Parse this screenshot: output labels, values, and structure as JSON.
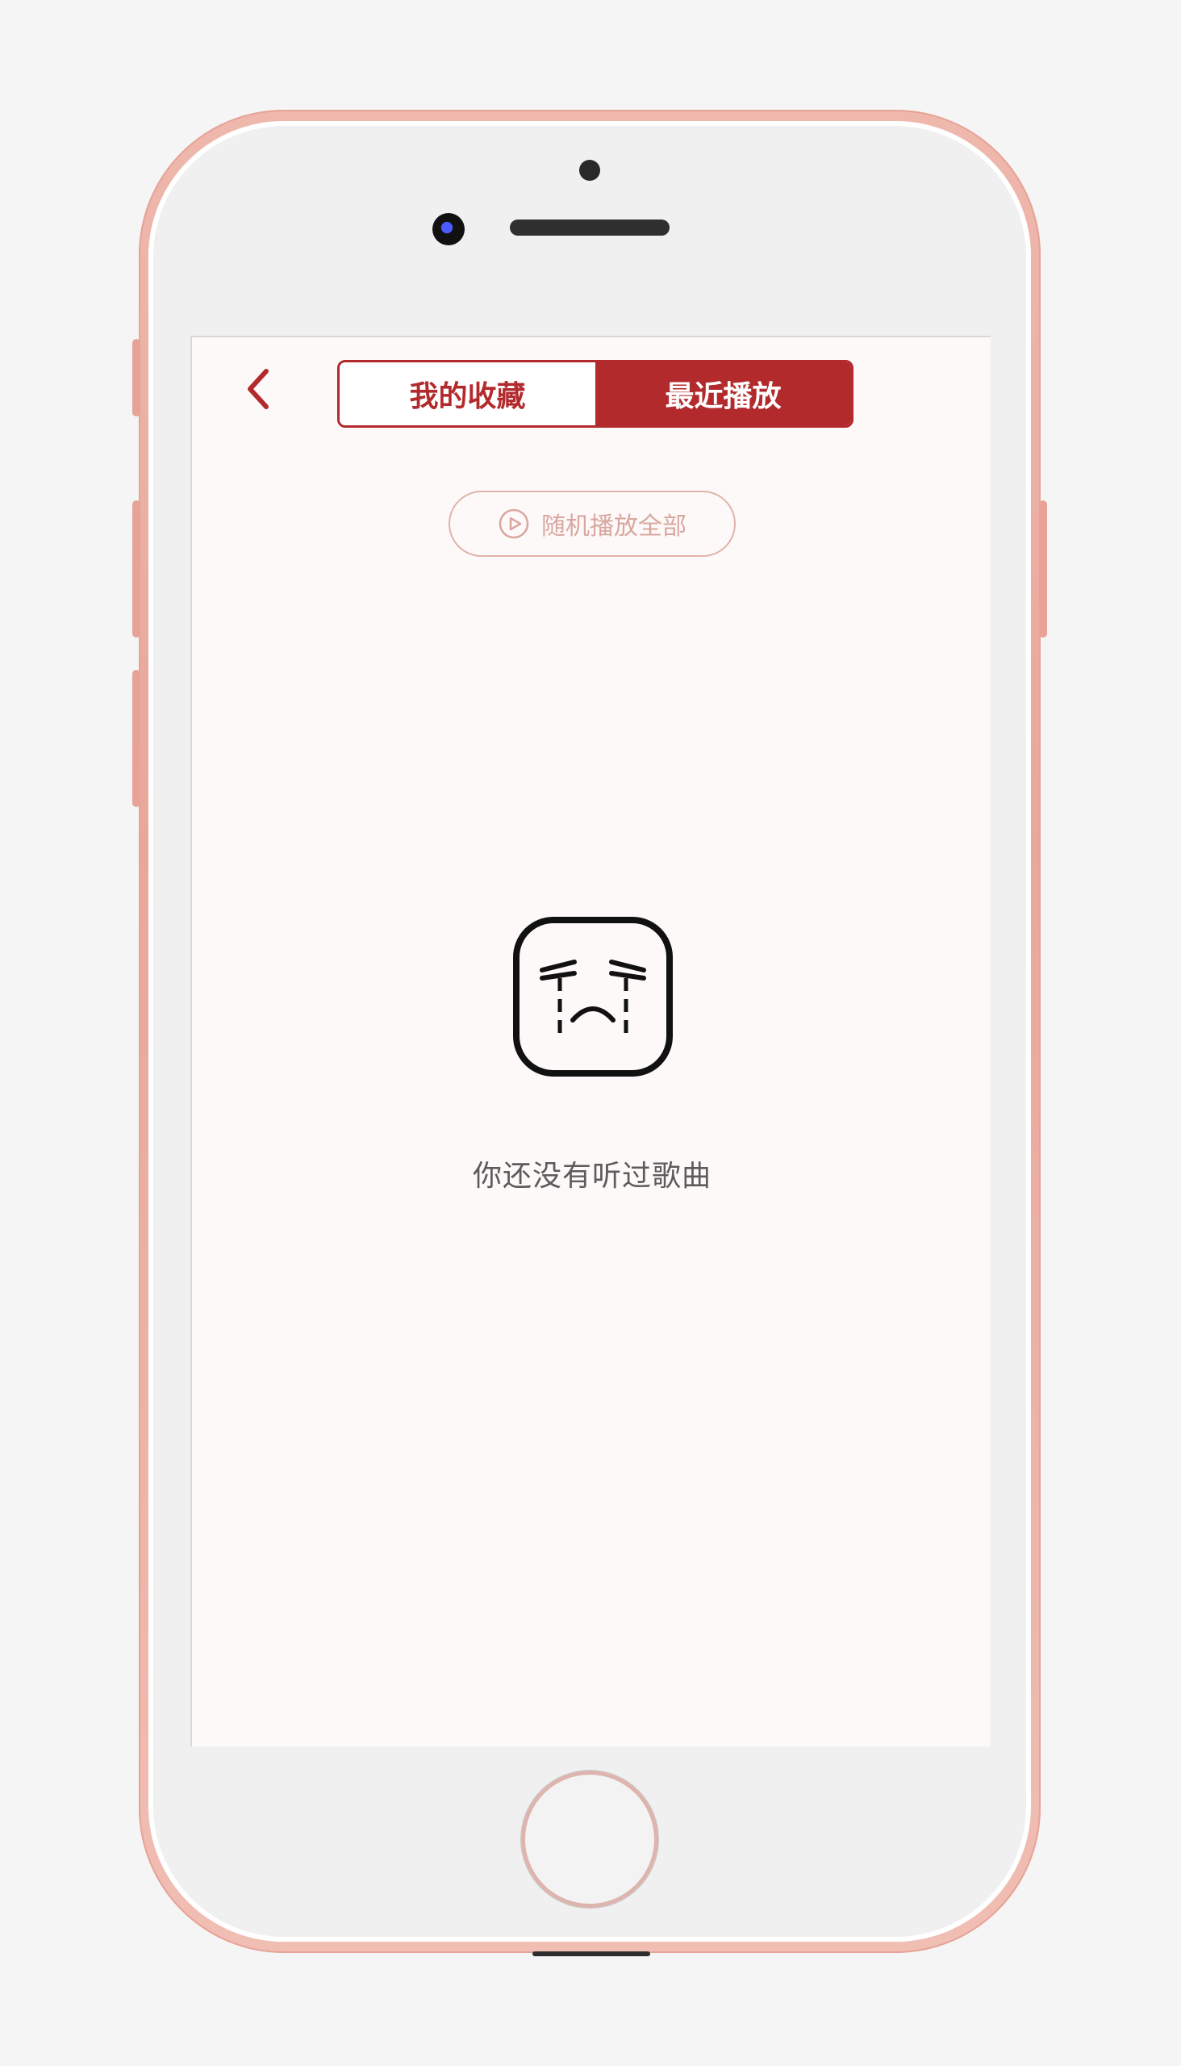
{
  "header": {
    "back_icon": "chevron-left-icon",
    "tabs": [
      {
        "label": "我的收藏",
        "active": false
      },
      {
        "label": "最近播放",
        "active": true
      }
    ]
  },
  "actions": {
    "shuffle_all_label": "随机播放全部",
    "shuffle_icon": "play-circle-icon"
  },
  "empty_state": {
    "icon": "crying-face-icon",
    "message": "你还没有听过歌曲"
  },
  "colors": {
    "accent": "#b32a2d",
    "muted_accent": "#d9a79f",
    "background": "#fcf9f8",
    "frame": "#efb8ad"
  }
}
